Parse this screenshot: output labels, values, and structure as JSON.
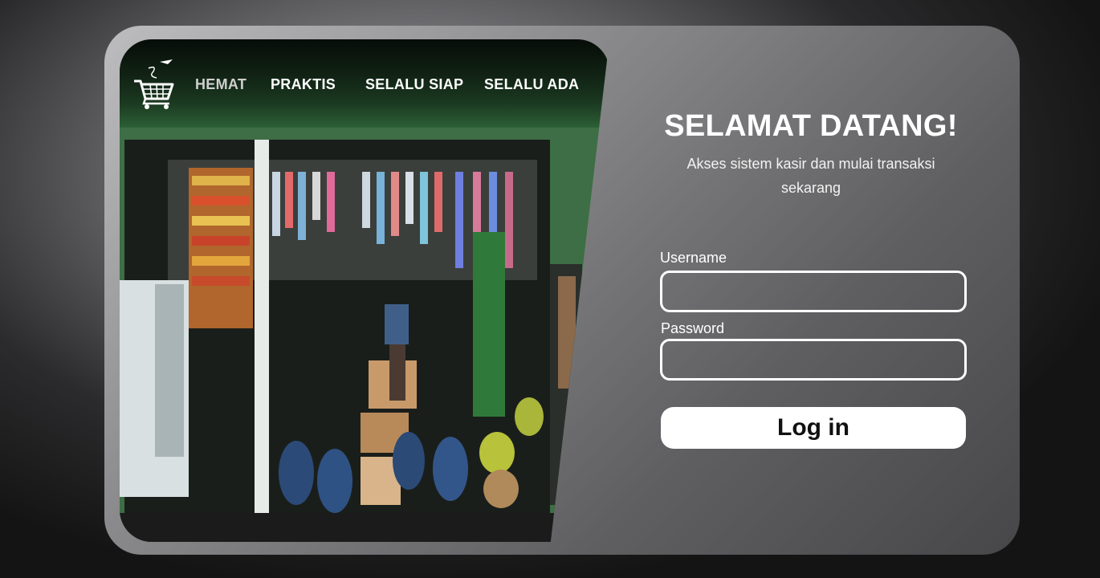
{
  "nav": {
    "items": [
      {
        "label": "HEMAT"
      },
      {
        "label": "PRAKTIS"
      },
      {
        "label": "SELALU SIAP"
      },
      {
        "label": "SELALU ADA"
      }
    ],
    "logo_icon": "shopping-cart-icon"
  },
  "hero": {
    "title": "SELAMAT DATANG!",
    "subtitle": "Akses sistem kasir dan mulai transaksi sekarang"
  },
  "form": {
    "username_label": "Username",
    "username_value": "",
    "password_label": "Password",
    "password_value": "",
    "submit_label": "Log in"
  },
  "colors": {
    "accent_button": "#ffffff",
    "button_text": "#111111",
    "input_border": "#ffffff"
  }
}
